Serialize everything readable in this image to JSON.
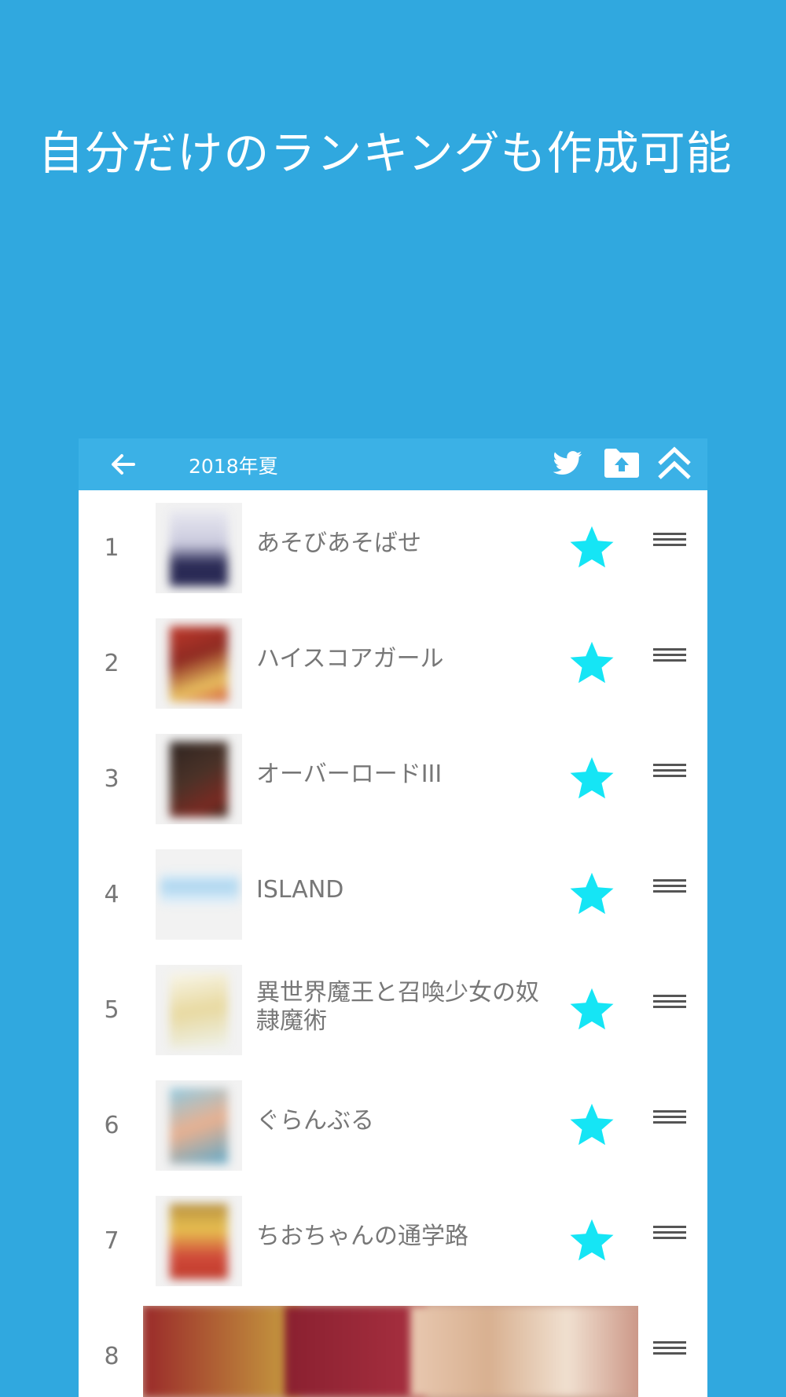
{
  "promo": {
    "title": "自分だけのランキングも作成可能"
  },
  "appbar": {
    "title": "2018年夏",
    "icons": [
      "back-arrow-icon",
      "twitter-icon",
      "folder-upload-icon",
      "scroll-top-icon"
    ]
  },
  "colors": {
    "background": "#30a8df",
    "appbar": "#3bb1e6",
    "star": "#15e5f5",
    "text": "#777777"
  },
  "list": {
    "items": [
      {
        "rank": "1",
        "title": "あそびあそばせ",
        "cover_colors": [
          "#e8e8f0",
          "#2a2a55"
        ]
      },
      {
        "rank": "2",
        "title": "ハイスコアガール",
        "cover_colors": [
          "#c0392b",
          "#e8c060"
        ]
      },
      {
        "rank": "3",
        "title": "オーバーロードIII",
        "cover_colors": [
          "#4a3228",
          "#7a2a22"
        ]
      },
      {
        "rank": "4",
        "title": "ISLAND",
        "cover_colors": [
          "#a9d4ef",
          "#e9f3fa"
        ]
      },
      {
        "rank": "5",
        "title": "異世界魔王と召喚少女の奴隷魔術",
        "cover_colors": [
          "#f4f0da",
          "#e8d9a0"
        ]
      },
      {
        "rank": "6",
        "title": "ぐらんぶる",
        "cover_colors": [
          "#8fc9e0",
          "#e8b090"
        ]
      },
      {
        "rank": "7",
        "title": "ちおちゃんの通学路",
        "cover_colors": [
          "#d04a3a",
          "#e8c050"
        ]
      },
      {
        "rank": "8",
        "title": "",
        "cover_colors": []
      }
    ]
  }
}
